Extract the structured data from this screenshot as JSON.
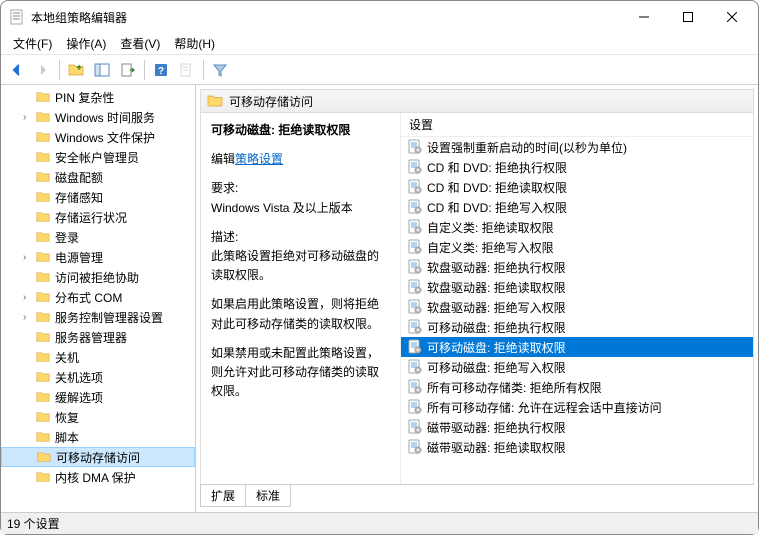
{
  "window": {
    "title": "本地组策略编辑器"
  },
  "menu": {
    "file": "文件(F)",
    "action": "操作(A)",
    "view": "查看(V)",
    "help": "帮助(H)"
  },
  "tree": {
    "items": [
      {
        "label": "PIN 复杂性",
        "chev": ""
      },
      {
        "label": "Windows 时间服务",
        "chev": "›"
      },
      {
        "label": "Windows 文件保护",
        "chev": ""
      },
      {
        "label": "安全帐户管理员",
        "chev": ""
      },
      {
        "label": "磁盘配额",
        "chev": ""
      },
      {
        "label": "存储感知",
        "chev": ""
      },
      {
        "label": "存储运行状况",
        "chev": ""
      },
      {
        "label": "登录",
        "chev": ""
      },
      {
        "label": "电源管理",
        "chev": "›"
      },
      {
        "label": "访问被拒绝协助",
        "chev": ""
      },
      {
        "label": "分布式 COM",
        "chev": "›"
      },
      {
        "label": "服务控制管理器设置",
        "chev": "›"
      },
      {
        "label": "服务器管理器",
        "chev": ""
      },
      {
        "label": "关机",
        "chev": ""
      },
      {
        "label": "关机选项",
        "chev": ""
      },
      {
        "label": "缓解选项",
        "chev": ""
      },
      {
        "label": "恢复",
        "chev": ""
      },
      {
        "label": "脚本",
        "chev": ""
      },
      {
        "label": "可移动存储访问",
        "chev": "",
        "selected": true
      },
      {
        "label": "内核 DMA 保护",
        "chev": ""
      }
    ]
  },
  "content": {
    "header": "可移动存储访问",
    "detail": {
      "title": "可移动磁盘: 拒绝读取权限",
      "edit_prefix": "编辑",
      "edit_link": "策略设置",
      "req_label": "要求:",
      "req_value": "Windows Vista 及以上版本",
      "desc_label": "描述:",
      "desc_body1": "此策略设置拒绝对可移动磁盘的读取权限。",
      "desc_body2": "如果启用此策略设置，则将拒绝对此可移动存储类的读取权限。",
      "desc_body3": "如果禁用或未配置此策略设置，则允许对此可移动存储类的读取权限。"
    },
    "settings_header": "设置",
    "settings": [
      {
        "label": "设置强制重新启动的时间(以秒为单位)"
      },
      {
        "label": "CD 和 DVD: 拒绝执行权限"
      },
      {
        "label": "CD 和 DVD: 拒绝读取权限"
      },
      {
        "label": "CD 和 DVD: 拒绝写入权限"
      },
      {
        "label": "自定义类: 拒绝读取权限"
      },
      {
        "label": "自定义类: 拒绝写入权限"
      },
      {
        "label": "软盘驱动器: 拒绝执行权限"
      },
      {
        "label": "软盘驱动器: 拒绝读取权限"
      },
      {
        "label": "软盘驱动器: 拒绝写入权限"
      },
      {
        "label": "可移动磁盘: 拒绝执行权限"
      },
      {
        "label": "可移动磁盘: 拒绝读取权限",
        "selected": true
      },
      {
        "label": "可移动磁盘: 拒绝写入权限"
      },
      {
        "label": "所有可移动存储类: 拒绝所有权限"
      },
      {
        "label": "所有可移动存储: 允许在远程会话中直接访问"
      },
      {
        "label": "磁带驱动器: 拒绝执行权限"
      },
      {
        "label": "磁带驱动器: 拒绝读取权限"
      }
    ],
    "tabs": {
      "extended": "扩展",
      "standard": "标准"
    }
  },
  "status": "19 个设置"
}
